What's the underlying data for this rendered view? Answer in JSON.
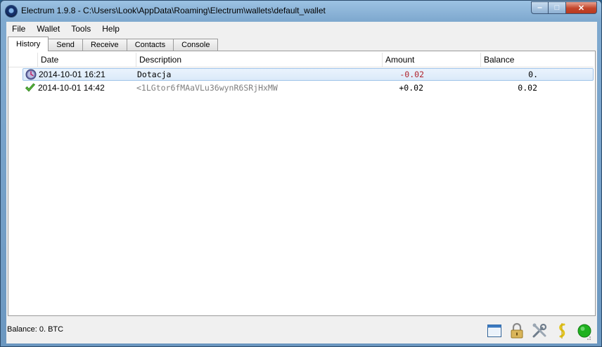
{
  "window": {
    "title": "Electrum 1.9.8  -  C:\\Users\\Look\\AppData\\Roaming\\Electrum\\wallets\\default_wallet",
    "buttons": {
      "minimize": "‒",
      "maximize": "□",
      "close": "✕"
    }
  },
  "menu": [
    "File",
    "Wallet",
    "Tools",
    "Help"
  ],
  "tabs": [
    "History",
    "Send",
    "Receive",
    "Contacts",
    "Console"
  ],
  "active_tab": "History",
  "history": {
    "columns": [
      "Date",
      "Description",
      "Amount",
      "Balance"
    ],
    "rows": [
      {
        "status_icon": "clock-icon",
        "date": "2014-10-01 16:21",
        "description": "Dotacja",
        "amount": "-0.02",
        "balance": "0.",
        "selected": true
      },
      {
        "status_icon": "checkmark-icon",
        "date": "2014-10-01 14:42",
        "description": "<1LGtor6fMAaVLu36wynR6SRjHxMW",
        "amount": "+0.02",
        "balance": "0.02",
        "selected": false
      }
    ]
  },
  "status_bar": {
    "balance_text": "Balance: 0. BTC",
    "icons": [
      "window-icon",
      "lock-icon",
      "tools-icon",
      "seed-icon",
      "network-status-icon"
    ]
  },
  "colors": {
    "negative_amount": "#b0242d",
    "positive_amount": "#000000",
    "description_address": "#808080",
    "connected": "#1fb11f"
  }
}
